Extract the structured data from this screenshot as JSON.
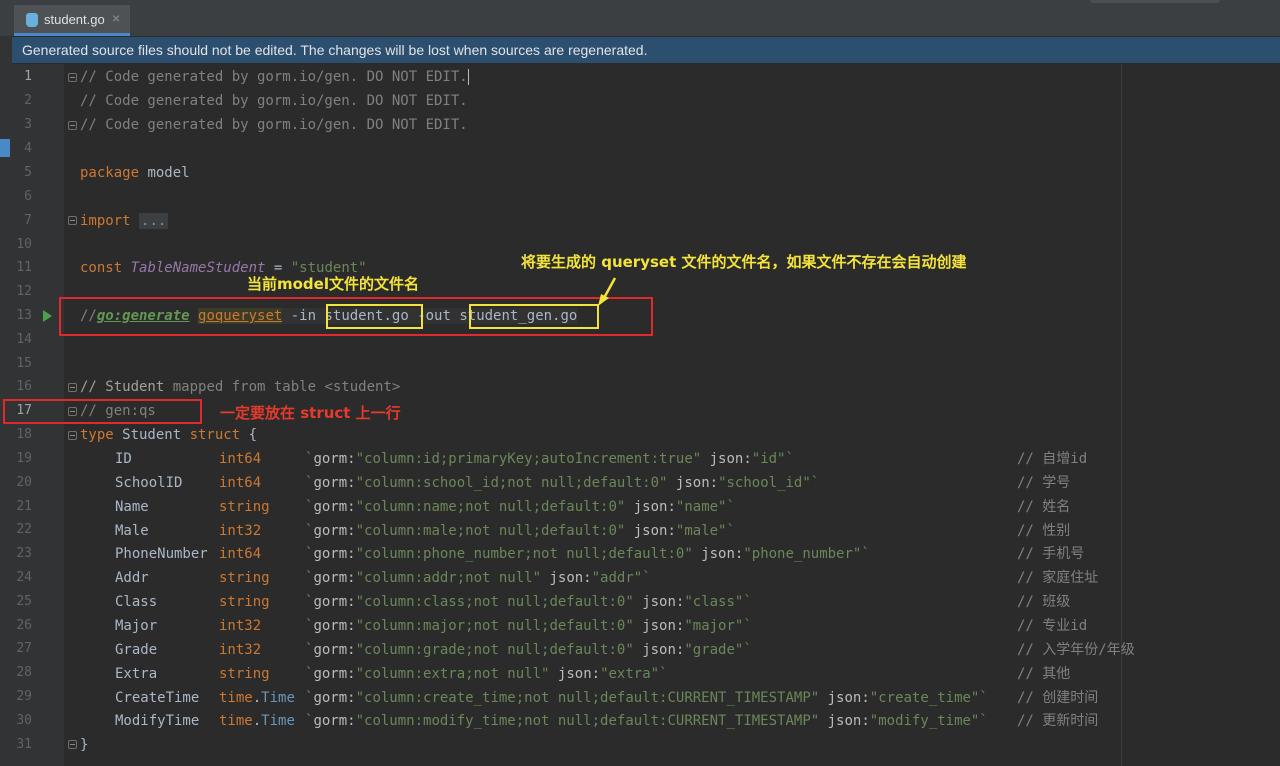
{
  "tab": {
    "label": "student.go",
    "close": "×"
  },
  "banner": "Generated source files should not be edited. The changes will be lost when sources are regenerated.",
  "line_numbers": [
    "1",
    "2",
    "3",
    "4",
    "5",
    "6",
    "7",
    "10",
    "11",
    "12",
    "13",
    "14",
    "15",
    "16",
    "17",
    "18",
    "19",
    "20",
    "21",
    "22",
    "23",
    "24",
    "25",
    "26",
    "27",
    "28",
    "29",
    "30",
    "31"
  ],
  "code": {
    "l1": "// Code generated by gorm.io/gen. DO NOT EDIT.",
    "l2": "// Code generated by gorm.io/gen. DO NOT EDIT.",
    "l3": "// Code generated by gorm.io/gen. DO NOT EDIT.",
    "package_kw": "package",
    "package_name": " model",
    "import_kw": "import",
    "import_folded": "...",
    "const_kw": "const",
    "const_name": "TableNameStudent",
    "const_eq": " = ",
    "const_val": "\"student\"",
    "gen_prefix": "//",
    "gen_directive": "go:generate",
    "gen_tool": "goqueryset",
    "gen_in_flag": " -in ",
    "gen_in_file": "student.go",
    "gen_out_flag": " -out ",
    "gen_out_file": "student_gen.go",
    "c16a": "// Student",
    "c16b": " mapped from table <student>",
    "c17": "// gen:qs",
    "type_kw": "type",
    "struct_name": " Student ",
    "struct_kw": "struct",
    "brace_open": " {",
    "brace_close": "}"
  },
  "fields": [
    {
      "name": "ID",
      "type": "int64",
      "tag_parts": [
        [
          "gorm",
          "\"column:id;primaryKey;autoIncrement:true\""
        ],
        [
          "json",
          "\"id\""
        ]
      ],
      "comment": "// 自增id"
    },
    {
      "name": "SchoolID",
      "type": "int64",
      "tag_parts": [
        [
          "gorm",
          "\"column:school_id;not null;default:0\""
        ],
        [
          "json",
          "\"school_id\""
        ]
      ],
      "comment": "// 学号"
    },
    {
      "name": "Name",
      "type": "string",
      "tag_parts": [
        [
          "gorm",
          "\"column:name;not null;default:0\""
        ],
        [
          "json",
          "\"name\""
        ]
      ],
      "comment": "// 姓名"
    },
    {
      "name": "Male",
      "type": "int32",
      "tag_parts": [
        [
          "gorm",
          "\"column:male;not null;default:0\""
        ],
        [
          "json",
          "\"male\""
        ]
      ],
      "comment": "// 性别"
    },
    {
      "name": "PhoneNumber",
      "type": "int64",
      "tag_parts": [
        [
          "gorm",
          "\"column:phone_number;not null;default:0\""
        ],
        [
          "json",
          "\"phone_number\""
        ]
      ],
      "comment": "// 手机号"
    },
    {
      "name": "Addr",
      "type": "string",
      "tag_parts": [
        [
          "gorm",
          "\"column:addr;not null\""
        ],
        [
          "json",
          "\"addr\""
        ]
      ],
      "comment": "// 家庭住址"
    },
    {
      "name": "Class",
      "type": "string",
      "tag_parts": [
        [
          "gorm",
          "\"column:class;not null;default:0\""
        ],
        [
          "json",
          "\"class\""
        ]
      ],
      "comment": "// 班级"
    },
    {
      "name": "Major",
      "type": "int32",
      "tag_parts": [
        [
          "gorm",
          "\"column:major;not null;default:0\""
        ],
        [
          "json",
          "\"major\""
        ]
      ],
      "comment": "// 专业id"
    },
    {
      "name": "Grade",
      "type": "int32",
      "tag_parts": [
        [
          "gorm",
          "\"column:grade;not null;default:0\""
        ],
        [
          "json",
          "\"grade\""
        ]
      ],
      "comment": "// 入学年份/年级"
    },
    {
      "name": "Extra",
      "type": "string",
      "tag_parts": [
        [
          "gorm",
          "\"column:extra;not null\""
        ],
        [
          "json",
          "\"extra\""
        ]
      ],
      "comment": "// 其他"
    },
    {
      "name": "CreateTime",
      "type": "time.Time",
      "tag_parts": [
        [
          "gorm",
          "\"column:create_time;not null;default:CURRENT_TIMESTAMP\""
        ],
        [
          "json",
          "\"create_time\""
        ]
      ],
      "comment": "// 创建时间"
    },
    {
      "name": "ModifyTime",
      "type": "time.Time",
      "tag_parts": [
        [
          "gorm",
          "\"column:modify_time;not null;default:CURRENT_TIMESTAMP\""
        ],
        [
          "json",
          "\"modify_time\""
        ]
      ],
      "comment": "// 更新时间"
    }
  ],
  "annotations": {
    "out_file_note": "将要生成的 queryset 文件的文件名，如果文件不存在会自动创建",
    "in_file_note": "当前model文件的文件名",
    "struct_note": "一定要放在 struct 上一行"
  },
  "colors": {
    "annotation_red": "#e0292a",
    "annotation_yellow": "#f2e33c",
    "banner_bg": "#2d4f6f"
  }
}
